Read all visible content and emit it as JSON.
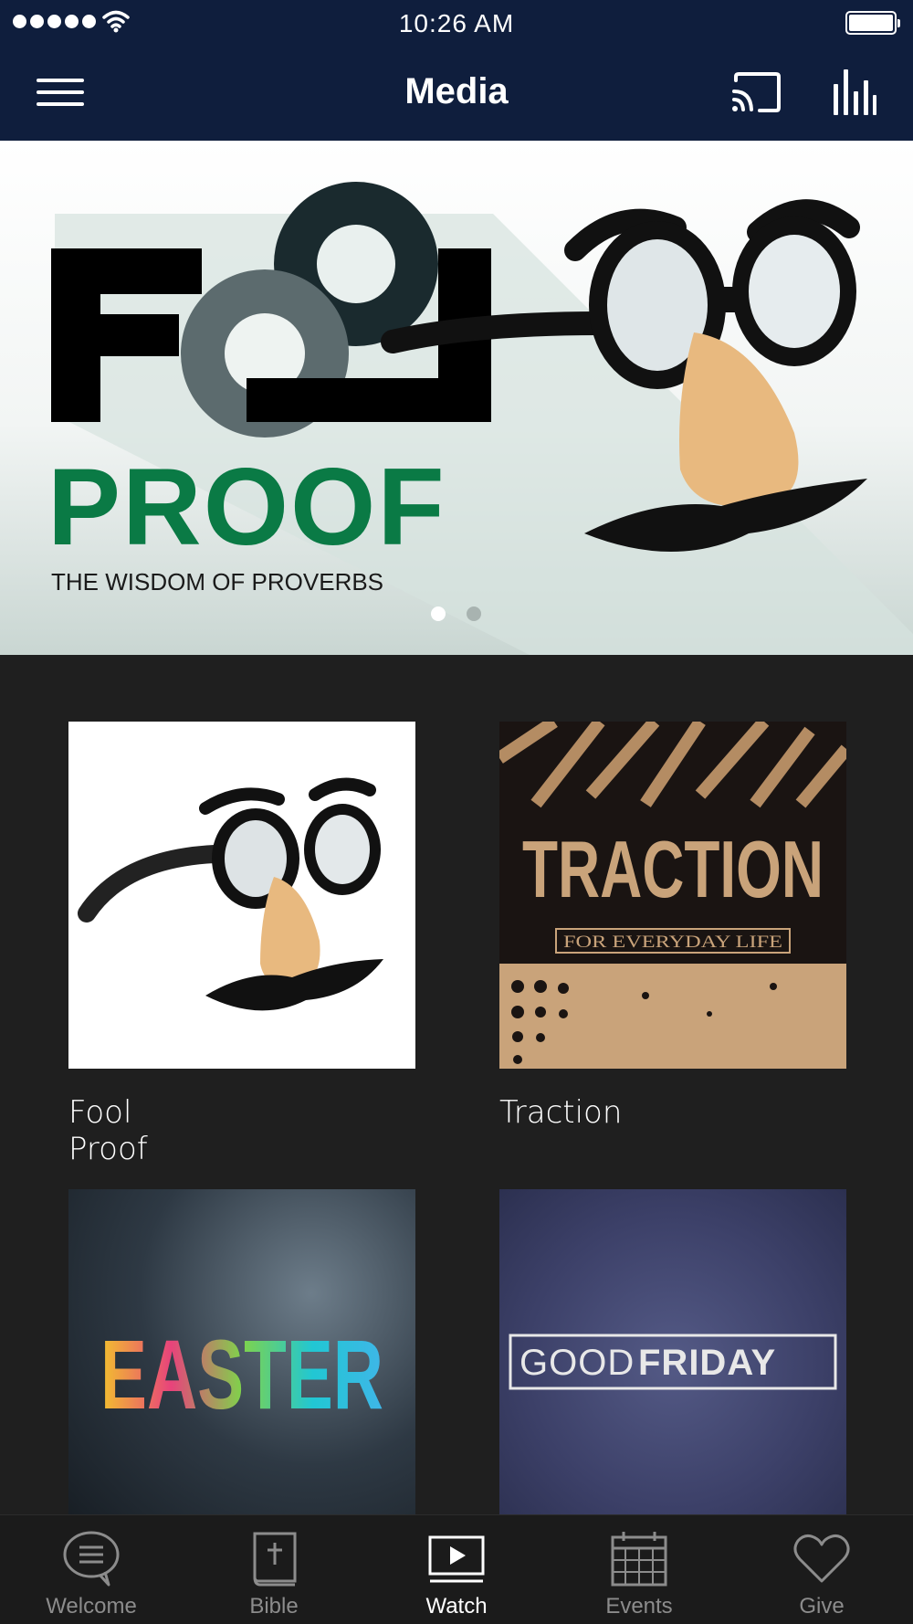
{
  "status_bar": {
    "time": "10:26 AM",
    "signal_icon": "signal-dots-icon",
    "wifi_icon": "wifi-icon",
    "battery_icon": "battery-icon",
    "battery_level": 1.0
  },
  "nav": {
    "title": "Media",
    "menu_icon": "hamburger-menu-icon",
    "cast_icon": "cast-icon",
    "stats_icon": "bar-chart-icon",
    "background": "#0f1e3d"
  },
  "hero": {
    "title_top": "FOOL",
    "title_bottom": "PROOF",
    "subtitle": "THE WISDOM OF PROVERBS",
    "page_count": 2,
    "active_page": 1
  },
  "series": [
    {
      "caption": "Fool Proof",
      "artwork": "glasses-nose-mustache"
    },
    {
      "caption": "Traction",
      "artwork_title": "TRACTION",
      "artwork_subtitle": "FOR EVERYDAY LIFE"
    },
    {
      "caption": "",
      "artwork_title": "EASTER"
    },
    {
      "caption": "",
      "artwork_title_a": "GOOD",
      "artwork_title_b": "FRIDAY"
    }
  ],
  "tabs": [
    {
      "label": "Welcome",
      "icon": "chat-bubble-icon",
      "active": false
    },
    {
      "label": "Bible",
      "icon": "bible-icon",
      "active": false
    },
    {
      "label": "Watch",
      "icon": "play-screen-icon",
      "active": true
    },
    {
      "label": "Events",
      "icon": "calendar-icon",
      "active": false
    },
    {
      "label": "Give",
      "icon": "heart-icon",
      "active": false
    }
  ],
  "colors": {
    "background": "#1f1f1f",
    "tab_bar": "#1b1b1b",
    "proof_green": "#0a7a45",
    "traction_tan": "#c9a37a"
  }
}
